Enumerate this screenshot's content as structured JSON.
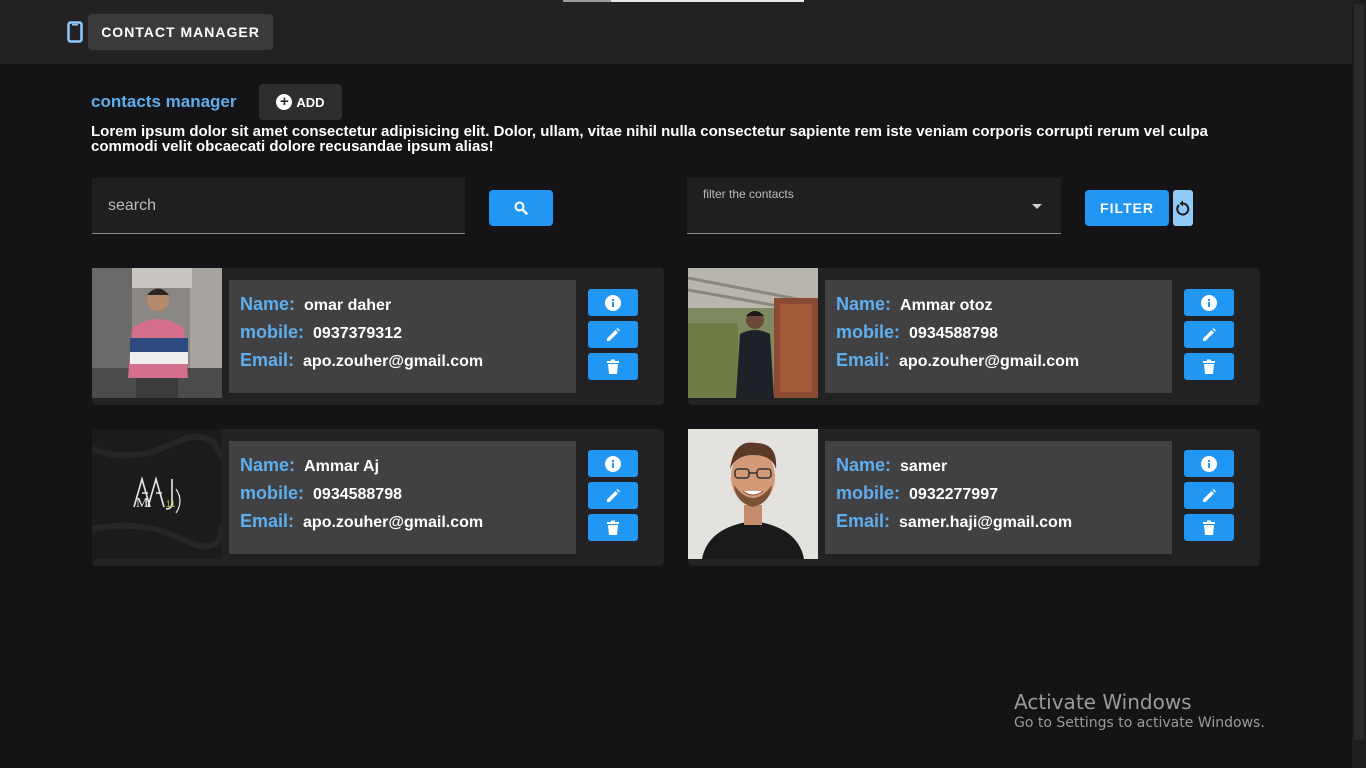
{
  "app": {
    "title": "CONTACT MANAGER"
  },
  "header": {
    "title": "contacts manager",
    "add_label": "ADD",
    "description": "Lorem ipsum dolor sit amet consectetur adipisicing elit. Dolor, ullam, vitae nihil nulla consectetur sapiente rem iste veniam corporis corrupti rerum vel culpa commodi velit obcaecati dolore recusandae ipsum alias!"
  },
  "search": {
    "placeholder": "search",
    "value": ""
  },
  "filter": {
    "label": "filter the contacts",
    "button_label": "FILTER"
  },
  "labels": {
    "name": "Name:",
    "mobile": "mobile:",
    "email": "Email:"
  },
  "contacts": [
    {
      "name": "omar daher",
      "mobile": "0937379312",
      "email": "apo.zouher@gmail.com"
    },
    {
      "name": "Ammar otoz",
      "mobile": "0934588798",
      "email": "apo.zouher@gmail.com"
    },
    {
      "name": "Ammar Aj",
      "mobile": "0934588798",
      "email": "apo.zouher@gmail.com",
      "logo_text": "AAJ M 11"
    },
    {
      "name": "samer",
      "mobile": "0932277997",
      "email": "samer.haji@gmail.com"
    }
  ],
  "watermark": {
    "line1": "Activate Windows",
    "line2": "Go to Settings to activate Windows."
  },
  "colors": {
    "accent": "#2196f3",
    "label": "#5eaeee",
    "background": "#141416",
    "card": "#222224"
  }
}
